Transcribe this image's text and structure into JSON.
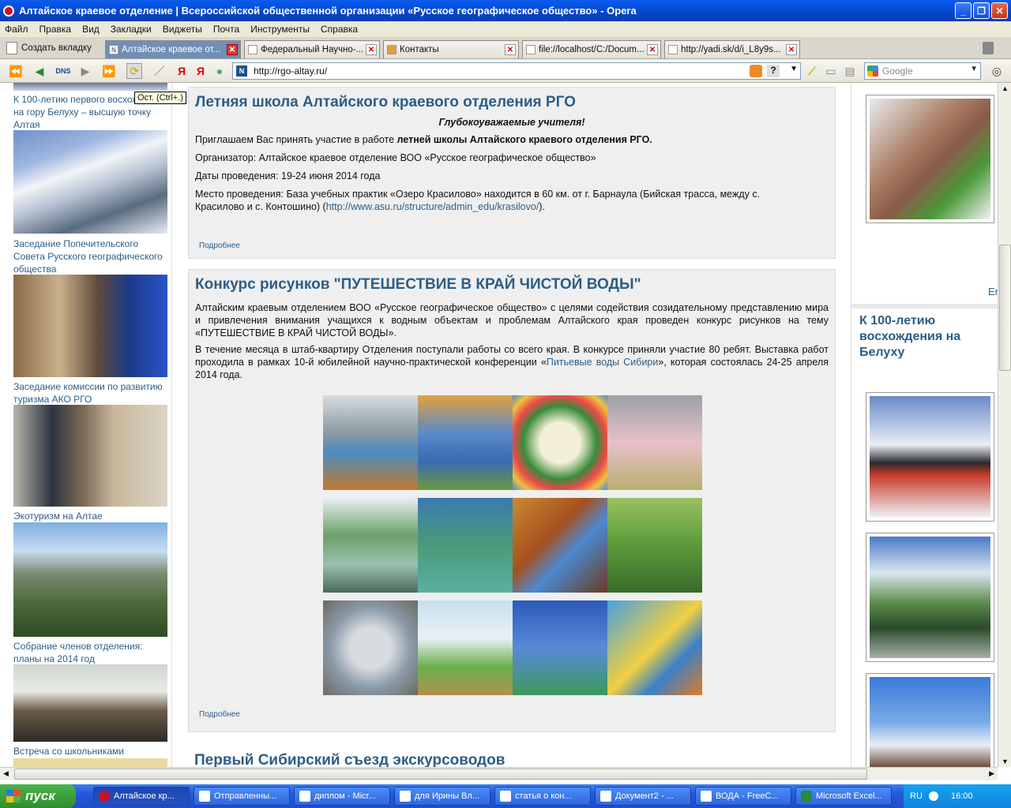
{
  "window": {
    "title": "Алтайское краевое отделение | Всероссийской общественной организации «Русское географическое общество» - Opera"
  },
  "menu": [
    "Файл",
    "Правка",
    "Вид",
    "Закладки",
    "Виджеты",
    "Почта",
    "Инструменты",
    "Справка"
  ],
  "tabbar": {
    "new_tab": "Создать вкладку",
    "tabs": [
      "Алтайское краевое от...",
      "Федеральный Научно-...",
      "Контакты",
      "file://localhost/C:/Docum...",
      "http://yadi.sk/d/i_L8y9s..."
    ]
  },
  "toolbar": {
    "url": "http://rgo-altay.ru/",
    "search_placeholder": "Google",
    "tooltip": "Ост. (Ctrl+.)"
  },
  "left": {
    "captions": [
      "К 100-летию первого восхождения на гору Белуху – высшую точку Алтая",
      "Заседание Попечительского Совета Русского географического общества",
      "Заседание комиссии по развитию туризма АКО РГО",
      "Экотуризм на Алтае",
      "Собрание членов отделения: планы на 2014 год",
      "Встреча со школьниками"
    ]
  },
  "articles": [
    {
      "title": "Летняя школа Алтайского краевого отделения РГО",
      "greeting": "Глубокоуважаемые учителя!",
      "p1_a": "Приглашаем Вас принять участие в работе ",
      "p1_b": "летней школы Алтайского краевого отделения РГО.",
      "p2": "Организатор:  Алтайское краевое отделение ВОО «Русское географическое общество»",
      "p3": "Даты проведения:  19-24 июня 2014 года",
      "p4_a": "Место проведения: База учебных практик «Озеро Красилово» находится в 60 км. от г. Барнаула (Бийская трасса, между с. Красилово и с. Контошино) (",
      "p4_link": "http://www.asu.ru/structure/admin_edu/krasilovo/",
      "p4_b": ").",
      "more": "Подробнее"
    },
    {
      "title": "Конкурс рисунков \"ПУТЕШЕСТВИЕ В КРАЙ ЧИСТОЙ ВОДЫ\"",
      "p1": "Алтайским краевым отделением ВОО «Русское географическое общество» с целями содействия созидательному представлению мира и привлечения внимания учащихся к водным объектам и проблемам Алтайского края проведен конкурс рисунков на тему «ПУТЕШЕСТВИЕ В КРАЙ ЧИСТОЙ ВОДЫ».",
      "p2_a": "В течение месяца в штаб-квартиру Отделения поступали работы со всего края. В конкурсе приняли участие 80 ребят. Выставка работ проходила в рамках 10-й юбилейной научно-практической конференции «",
      "p2_link": "Питьевые воды Сибири",
      "p2_b": "», которая состоялась 24-25 апреля 2014 года.",
      "more": "Подробнее"
    },
    {
      "title": "Первый Сибирский съезд экскурсоводов"
    }
  ],
  "right": {
    "en": "En",
    "heading": "К 100-летию восхождения на Белуху"
  },
  "taskbar": {
    "start": "пуск",
    "tasks": [
      "Алтайское кр...",
      "Отправленны...",
      "диплом - Micr...",
      "для Ирины Вл...",
      "статья о кон...",
      "Документ2 - ...",
      "ВОДА - FreeC...",
      "Microsoft Excel..."
    ],
    "lang": "RU",
    "clock": "16:00"
  }
}
